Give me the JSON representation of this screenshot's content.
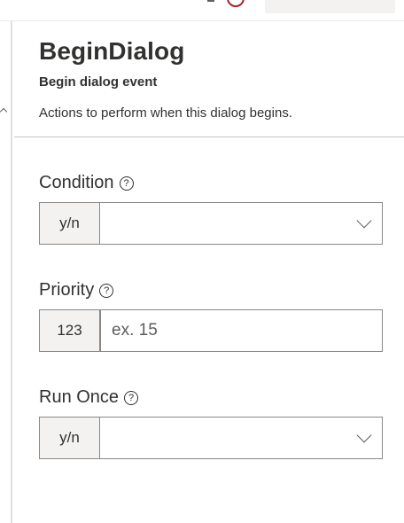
{
  "header": {
    "title": "BeginDialog",
    "subtitle": "Begin dialog event",
    "description": "Actions to perform when this dialog begins."
  },
  "fields": {
    "condition": {
      "label": "Condition",
      "type_tag": "y/n",
      "value": ""
    },
    "priority": {
      "label": "Priority",
      "type_tag": "123",
      "placeholder": "ex. 15",
      "value": ""
    },
    "run_once": {
      "label": "Run Once",
      "type_tag": "y/n",
      "value": ""
    }
  },
  "icons": {
    "help": "question-circle-icon",
    "dropdown": "chevron-down-icon"
  },
  "colors": {
    "border": "#8a8886",
    "type_tag_bg": "#f3f2f1",
    "text": "#323130",
    "accent_top": "#a4262c"
  }
}
